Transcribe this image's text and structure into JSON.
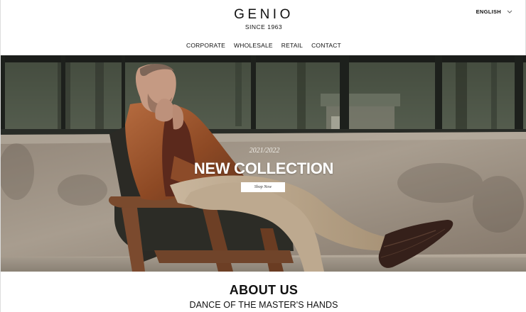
{
  "brand": {
    "name": "GENIO",
    "tagline": "SINCE 1963"
  },
  "language": {
    "selected": "ENGLISH"
  },
  "nav": {
    "items": [
      "CORPORATE",
      "WHOLESALE",
      "RETAIL",
      "CONTACT"
    ]
  },
  "hero": {
    "season": "2021/2022",
    "headline": "NEW COLLECTION",
    "cta": "Shop Now"
  },
  "about": {
    "title": "ABOUT US",
    "subtitle": "DANCE OF THE MASTER'S HANDS"
  },
  "icons": {
    "language_dropdown": "chevron-down-icon"
  }
}
